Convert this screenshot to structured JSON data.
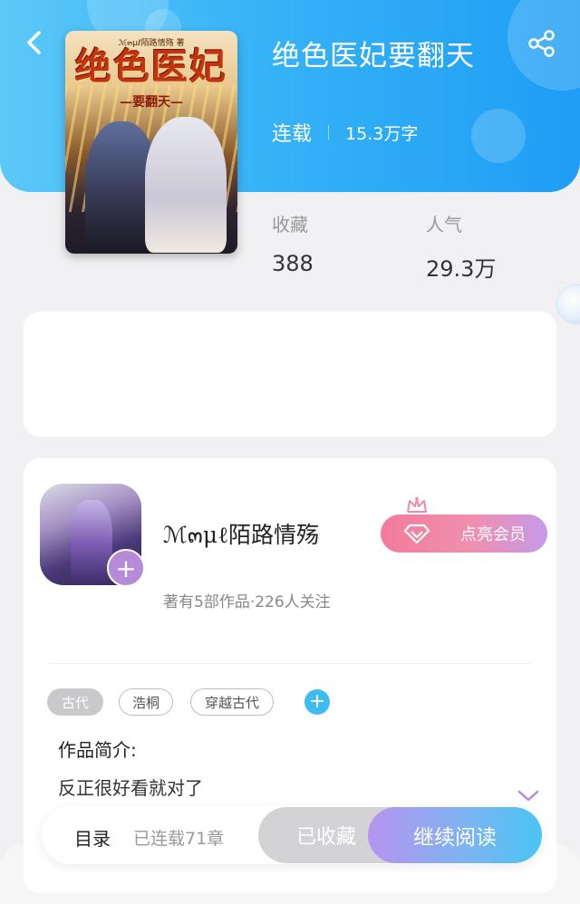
{
  "header": {
    "accent_gradient": [
      "#5cc8f7",
      "#1f9df5"
    ],
    "back_icon": "chevron-left-icon",
    "share_icon": "share-icon"
  },
  "book": {
    "title": "绝色医妃要翻天",
    "status": "连载",
    "word_count": "15.3万字",
    "cover": {
      "author_line": "ℳ๓μℓ陌路情殇 著",
      "big_title": "绝色医妃",
      "sub_title": "—要翻天—"
    }
  },
  "stats": {
    "favorites_label": "收藏",
    "favorites_value": "388",
    "popularity_label": "人气",
    "popularity_value": "29.3万"
  },
  "author": {
    "name": "ℳ๓μℓ陌路情殇",
    "meta": "著有5部作品·226人关注",
    "vip_button": "点亮会员",
    "vip_colors": [
      "#f27b9a",
      "#c59ae8"
    ]
  },
  "tags": [
    "古代",
    "浩桐",
    "穿越古代"
  ],
  "intro": {
    "label": "作品简介:",
    "text": "反正很好看就对了"
  },
  "bottom_bar": {
    "toc_label": "目录",
    "toc_count": "已连载71章",
    "collected_label": "已收藏",
    "continue_label": "继续阅读"
  }
}
